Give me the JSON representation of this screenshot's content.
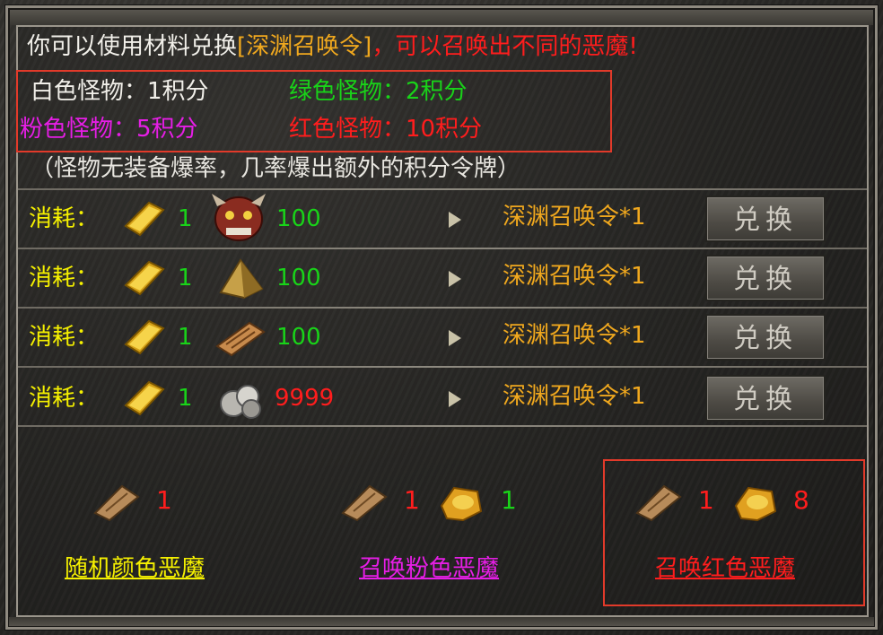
{
  "intro": {
    "prefix": "你可以使用材料兑换",
    "item": "[深渊召唤令]",
    "suffix": "，可以召唤出不同的恶魔!"
  },
  "legend": {
    "white": "白色怪物：1积分",
    "green": "绿色怪物：2积分",
    "pink": "粉色怪物：5积分",
    "red": "红色怪物：10积分"
  },
  "note": "（怪物无装备爆率，几率爆出额外的积分令牌）",
  "rows": [
    {
      "label": "消耗：",
      "gold_qty": "1",
      "material_icon": "demon-mask-icon",
      "material_qty": "100",
      "material_qty_color": "#19d319",
      "result": "深渊召唤令*1",
      "button": "兑换"
    },
    {
      "label": "消耗：",
      "gold_qty": "1",
      "material_icon": "crystal-shard-icon",
      "material_qty": "100",
      "material_qty_color": "#19d319",
      "result": "深渊召唤令*1",
      "button": "兑换"
    },
    {
      "label": "消耗：",
      "gold_qty": "1",
      "material_icon": "scroll-icon",
      "material_qty": "100",
      "material_qty_color": "#19d319",
      "result": "深渊召唤令*1",
      "button": "兑换"
    },
    {
      "label": "消耗：",
      "gold_qty": "1",
      "material_icon": "silver-ore-icon",
      "material_qty": "9999",
      "material_qty_color": "#ff1d1d",
      "result": "深渊召唤令*1",
      "button": "兑换"
    }
  ],
  "summons": [
    {
      "token_qty": "1",
      "link": "随机颜色恶魔",
      "link_color": "#f5f000"
    },
    {
      "token_qty": "1",
      "point_qty": "1",
      "link": "召唤粉色恶魔",
      "link_color": "#e61ee6"
    },
    {
      "token_qty": "1",
      "point_qty": "8",
      "link": "召唤红色恶魔",
      "link_color": "#ff1d1d"
    }
  ],
  "colors": {
    "highlight_box": "#e23a2a",
    "frame": "#9a958b"
  }
}
